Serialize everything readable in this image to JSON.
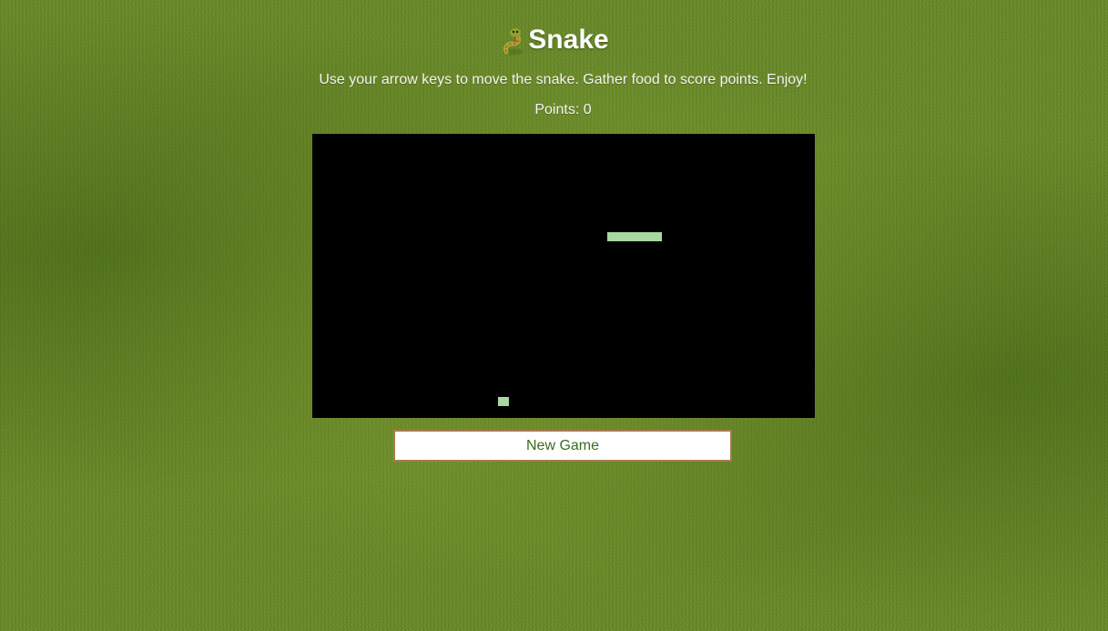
{
  "game": {
    "title": "Snake",
    "instructions": "Use your arrow keys to move the snake. Gather food to score points. Enjoy!",
    "score_text": "Points: 0",
    "score": 0,
    "new_game_label": "New Game",
    "logo_icon": "snake-icon"
  },
  "board": {
    "cols": 46,
    "rows": 26,
    "background": "#000000",
    "snake_color": "#a7d9a0",
    "food_color": "#a7d9a0",
    "snake": [
      {
        "col": 27,
        "row": 9
      },
      {
        "col": 28,
        "row": 9
      },
      {
        "col": 29,
        "row": 9
      },
      {
        "col": 30,
        "row": 9
      },
      {
        "col": 31,
        "row": 9
      }
    ],
    "food": {
      "col": 17,
      "row": 24
    }
  },
  "colors": {
    "accent_text": "#3e6b1f",
    "button_border": "#a77a52",
    "grass": "#6b8f28"
  }
}
